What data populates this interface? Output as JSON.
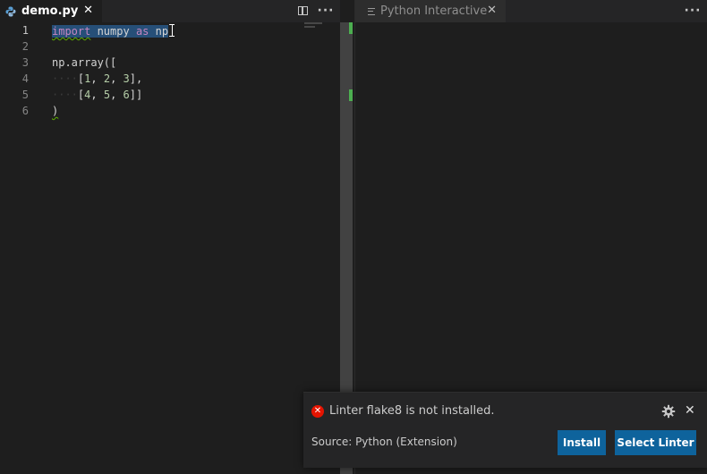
{
  "left_editor": {
    "tab": {
      "title": "demo.py",
      "icon": "python-file-icon"
    },
    "line_numbers": [
      "1",
      "2",
      "3",
      "4",
      "5",
      "6"
    ],
    "code": {
      "line1": {
        "kw": "import",
        "mod": " numpy ",
        "as": "as",
        "alias": " np"
      },
      "line3": "np.array([",
      "line4": {
        "indent": "····",
        "open": "[",
        "a": "1",
        "c1": ", ",
        "b": "2",
        "c2": ", ",
        "c": "3",
        "close": "],"
      },
      "line5": {
        "indent": "····",
        "open": "[",
        "a": "4",
        "c1": ", ",
        "b": "5",
        "c2": ", ",
        "c": "6",
        "close": "]]"
      },
      "line6": ")"
    },
    "actions": {
      "split": "split-editor-icon",
      "more": "···"
    }
  },
  "right_editor": {
    "tab": {
      "title": "Python Interactive",
      "icon": "preview-lines-icon"
    },
    "actions": {
      "more": "···"
    }
  },
  "notification": {
    "message": "Linter flake8 is not installed.",
    "source": "Source: Python (Extension)",
    "buttons": {
      "install": "Install",
      "select": "Select Linter"
    },
    "close": "✕"
  },
  "colors": {
    "accent_button": "#0e639c",
    "error": "#e51400",
    "selection": "#264f78",
    "keyword": "#c586c0"
  }
}
